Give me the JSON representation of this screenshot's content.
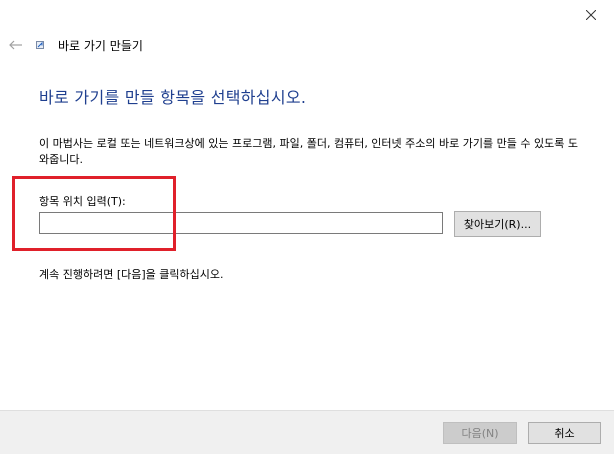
{
  "window": {
    "title": "바로 가기 만들기",
    "close_icon": "close-icon",
    "back_icon": "back-arrow-icon",
    "title_icon": "shortcut-wizard-icon"
  },
  "main": {
    "heading": "바로 가기를 만들 항목을 선택하십시오.",
    "description": "이 마법사는 로컬 또는 네트워크상에 있는 프로그램, 파일, 폴더, 컴퓨터, 인터넷 주소의 바로 가기를 만들 수 있도록 도와줍니다.",
    "location_label": "항목 위치 입력(T):",
    "location_value": "",
    "browse_label": "찾아보기(R)...",
    "instruction": "계속 진행하려면 [다음]을 클릭하십시오."
  },
  "footer": {
    "next_label": "다음(N)",
    "cancel_label": "취소"
  },
  "colors": {
    "heading": "#1f3f8f",
    "highlight": "#e0202a",
    "footer_bg": "#f0f0f0"
  }
}
